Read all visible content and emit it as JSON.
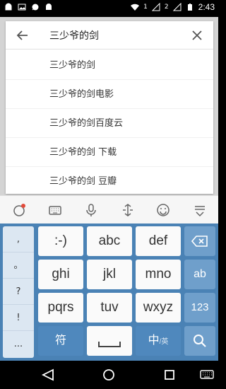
{
  "status_bar": {
    "sim1": "1",
    "sim2": "2",
    "time": "2:43"
  },
  "search": {
    "query": "三少爷的剑",
    "suggestions": [
      "三少爷的剑",
      "三少爷的剑电影",
      "三少爷的剑百度云",
      "三少爷的剑 下载",
      "三少爷的剑 豆瓣"
    ]
  },
  "keyboard": {
    "side_keys": [
      ",",
      "。",
      "?",
      "!",
      "..."
    ],
    "row1": [
      ":-)",
      "abc",
      "def"
    ],
    "row2": [
      "ghi",
      "jkl",
      "mno"
    ],
    "row3": [
      "pqrs",
      "tuv",
      "wxyz"
    ],
    "symbols_label": "符",
    "lang_label": "中",
    "lang_sub": "/英",
    "ab_label": "ab",
    "num_label": "123"
  },
  "colors": {
    "keyboard_bg": "#4a82b5",
    "key_bg": "#fafafa",
    "func_key_bg": "#6f9fcb"
  }
}
